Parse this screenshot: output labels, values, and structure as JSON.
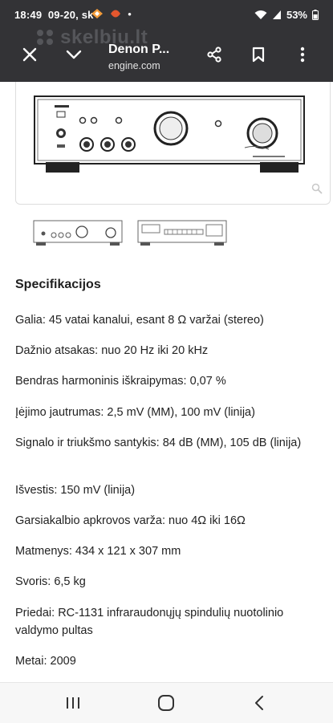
{
  "status": {
    "time": "18:49",
    "date": "09-20, sk",
    "dot": "•",
    "battery": "53%"
  },
  "watermark": "skelbiu.lt",
  "appbar": {
    "title": "Denon P...",
    "url": "engine.com"
  },
  "specs": {
    "title": "Specifikacijos",
    "items": [
      "Galia: 45 vatai kanalui, esant 8 Ω varžai (stereo)",
      "Dažnio atsakas: nuo 20 Hz iki 20 kHz",
      "Bendras harmoninis iškraipymas: 0,07 %",
      "Įėjimo jautrumas: 2,5 mV (MM), 100 mV (linija)",
      "Signalo ir triukšmo santykis: 84 dB (MM), 105 dB (linija)",
      "Išvestis: 150 mV (linija)",
      "Garsiakalbio apkrovos varža: nuo 4Ω iki 16Ω",
      "Matmenys: 434 x 121 x 307 mm",
      "Svoris: 6,5 kg",
      "Priedai: RC-1131 infraraudonųjų spindulių nuotolinio valdymo pultas",
      "Metai: 2009"
    ]
  },
  "icons": [
    "close-icon",
    "chevron-down-icon",
    "share-icon",
    "bookmark-icon",
    "more-vert-icon",
    "zoom-icon",
    "recents-icon",
    "home-icon",
    "back-icon",
    "wifi-icon",
    "signal-icon",
    "battery-icon"
  ]
}
